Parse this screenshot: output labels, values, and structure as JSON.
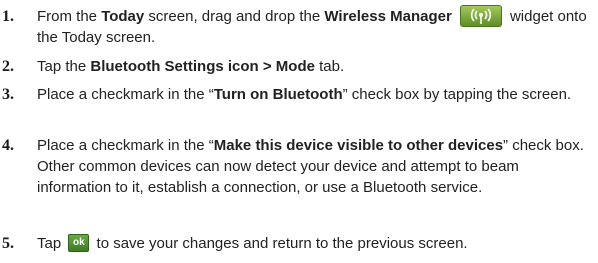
{
  "steps": [
    {
      "number": "1.",
      "parts": {
        "t1": "From the ",
        "b1": "Today",
        "t2": " screen, drag and drop the ",
        "b2": "Wireless Manager",
        "t3": " widget onto the Today screen."
      }
    },
    {
      "number": "2.",
      "parts": {
        "t1": "Tap the ",
        "b1": "Bluetooth Settings icon > Mode",
        "t2": " tab."
      }
    },
    {
      "number": "3.",
      "parts": {
        "t1": "Place a checkmark in the “",
        "b1": "Turn on Bluetooth",
        "t2": "” check box by tapping the screen."
      }
    },
    {
      "number": "4.",
      "parts": {
        "t1": "Place a checkmark in the “",
        "b1": "Make this device visible to other devices",
        "t2": "” check box. Other common devices can now detect your device and attempt to beam information to it, establish a connection, or use a Bluetooth service."
      }
    },
    {
      "number": "5.",
      "parts": {
        "t1": "Tap ",
        "icon_label": "ok",
        "t2": " to save your changes and return to the previous screen."
      }
    }
  ],
  "icons": {
    "wireless_manager": "wireless-manager-icon",
    "ok": "ok-button-icon",
    "accent": "#5f8d24"
  }
}
